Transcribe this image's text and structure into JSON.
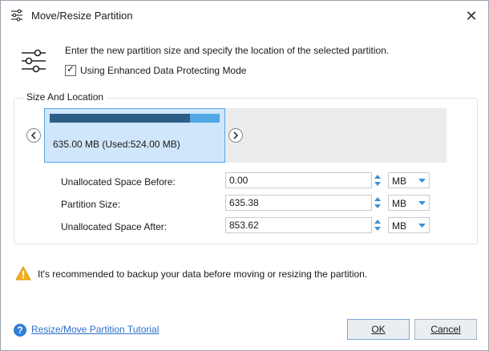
{
  "window": {
    "title": "Move/Resize Partition",
    "close_symbol": "✕"
  },
  "intro": {
    "text": "Enter the new partition size and specify the location of the selected partition.",
    "checkbox_label": "Using Enhanced Data Protecting Mode",
    "checkbox_checked": true
  },
  "size_location": {
    "group_label": "Size And Location",
    "partition_label": "635.00 MB (Used:524.00 MB)",
    "partition_size_mb": 635.0,
    "used_mb": 524.0
  },
  "fields": [
    {
      "label": "Unallocated Space Before:",
      "value": "0.00",
      "unit": "MB"
    },
    {
      "label": "Partition Size:",
      "value": "635.38",
      "unit": "MB"
    },
    {
      "label": "Unallocated Space After:",
      "value": "853.62",
      "unit": "MB"
    }
  ],
  "warning": {
    "text": "It's recommended to backup your data before moving or resizing the partition."
  },
  "footer": {
    "help_link": "Resize/Move Partition Tutorial",
    "ok_label": "OK",
    "cancel_label": "Cancel"
  },
  "colors": {
    "used_bar": "#2d5f86",
    "free_bar": "#52a7e5",
    "partition_bg": "#cfe6fb",
    "link": "#2f6fc8"
  }
}
